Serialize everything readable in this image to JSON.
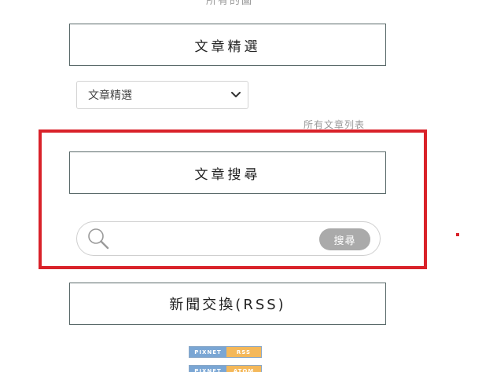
{
  "top_link": {
    "label": "所有的圖"
  },
  "featured": {
    "title": "文章精選",
    "select_value": "文章精選"
  },
  "all_articles": {
    "label": "所有文章列表"
  },
  "search": {
    "title": "文章搜尋",
    "placeholder": "",
    "button_label": "搜尋"
  },
  "rss": {
    "title": "新聞交換(RSS)",
    "badges": [
      {
        "left": "PIXNET",
        "right": "RSS"
      },
      {
        "left": "PIXNET",
        "right": "ATOM"
      }
    ]
  },
  "colors": {
    "highlight": "#d9222a",
    "button": "#aaaaaa",
    "badge_blue": "#7aa6d4",
    "badge_orange": "#f4b85a"
  }
}
